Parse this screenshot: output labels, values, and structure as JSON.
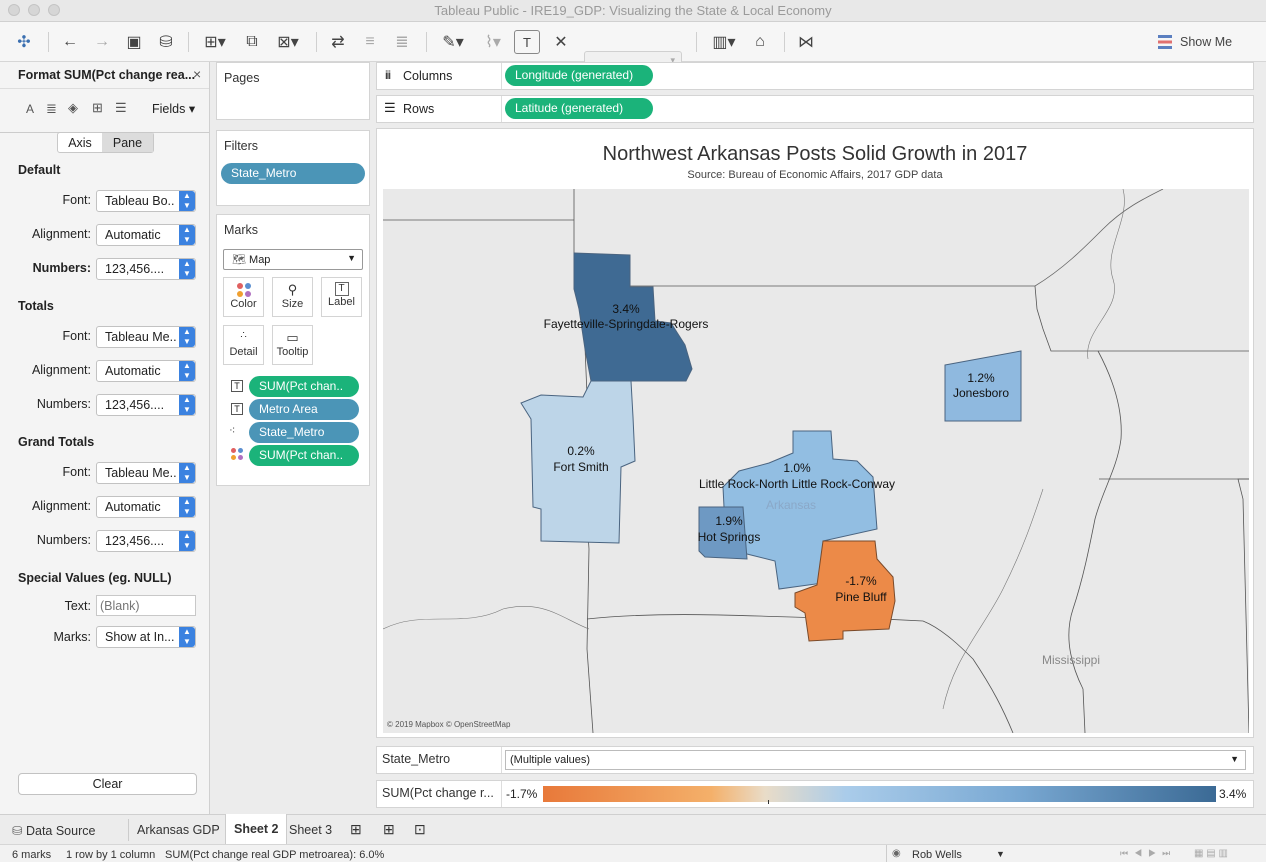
{
  "window": {
    "title": "Tableau Public - IRE19_GDP: Visualizing the State & Local Economy"
  },
  "toolbar": {
    "show_me": "Show Me"
  },
  "format_panel": {
    "title": "Format SUM(Pct change rea...",
    "fields_label": "Fields",
    "tabs": [
      "Axis",
      "Pane"
    ],
    "sections": {
      "default": {
        "heading": "Default",
        "font_label": "Font:",
        "font": "Tableau Bo..",
        "alignment_label": "Alignment:",
        "alignment": "Automatic",
        "numbers_label": "Numbers:",
        "numbers": "123,456...."
      },
      "totals": {
        "heading": "Totals",
        "font_label": "Font:",
        "font": "Tableau Me..",
        "alignment_label": "Alignment:",
        "alignment": "Automatic",
        "numbers_label": "Numbers:",
        "numbers": "123,456...."
      },
      "grand_totals": {
        "heading": "Grand Totals",
        "font_label": "Font:",
        "font": "Tableau Me..",
        "alignment_label": "Alignment:",
        "alignment": "Automatic",
        "numbers_label": "Numbers:",
        "numbers": "123,456...."
      },
      "special": {
        "heading": "Special Values (eg. NULL)",
        "text_label": "Text:",
        "text_placeholder": "(Blank)",
        "marks_label": "Marks:",
        "marks": "Show at In..."
      }
    },
    "clear_label": "Clear"
  },
  "pages": {
    "title": "Pages"
  },
  "filters": {
    "title": "Filters",
    "pill": "State_Metro"
  },
  "marks": {
    "title": "Marks",
    "type": "Map",
    "buttons": [
      "Color",
      "Size",
      "Label",
      "Detail",
      "Tooltip"
    ],
    "pills": [
      "SUM(Pct chan..",
      "Metro Area",
      "State_Metro",
      "SUM(Pct chan.."
    ]
  },
  "columns": {
    "label": "Columns",
    "pill": "Longitude (generated)"
  },
  "rows": {
    "label": "Rows",
    "pill": "Latitude (generated)"
  },
  "viz": {
    "title": "Northwest Arkansas Posts Solid Growth in 2017",
    "subtitle": "Source: Bureau of Economic Affairs, 2017 GDP data",
    "state_labels": [
      "Arkansas",
      "Mississippi"
    ],
    "attribution": "© 2019 Mapbox © OpenStreetMap",
    "regions": [
      {
        "name": "Fayetteville-Springdale-Rogers",
        "value": "3.4%",
        "color": "#3f6a93"
      },
      {
        "name": "Jonesboro",
        "value": "1.2%",
        "color": "#8fb9df"
      },
      {
        "name": "Fort Smith",
        "value": "0.2%",
        "color": "#bdd5e8"
      },
      {
        "name": "Little Rock-North Little Rock-Conway",
        "value": "1.0%",
        "color": "#92bee2"
      },
      {
        "name": "Hot Springs",
        "value": "1.9%",
        "color": "#6e99c3"
      },
      {
        "name": "Pine Bluff",
        "value": "-1.7%",
        "color": "#ec8a48"
      }
    ]
  },
  "filter_card": {
    "label": "State_Metro",
    "value": "(Multiple values)"
  },
  "legend": {
    "label": "SUM(Pct change r...",
    "min": "-1.7%",
    "max": "3.4%",
    "low_color": "#e8793a",
    "high_color": "#3b6a95"
  },
  "sheet_tabs": {
    "data_source": "Data Source",
    "tabs": [
      "Arkansas GDP",
      "Sheet 2",
      "Sheet 3"
    ],
    "active": "Sheet 2"
  },
  "status": {
    "marks": "6 marks",
    "rows": "1 row by 1 column",
    "sum": "SUM(Pct change real GDP metroarea): 6.0%",
    "user": "Rob Wells"
  }
}
